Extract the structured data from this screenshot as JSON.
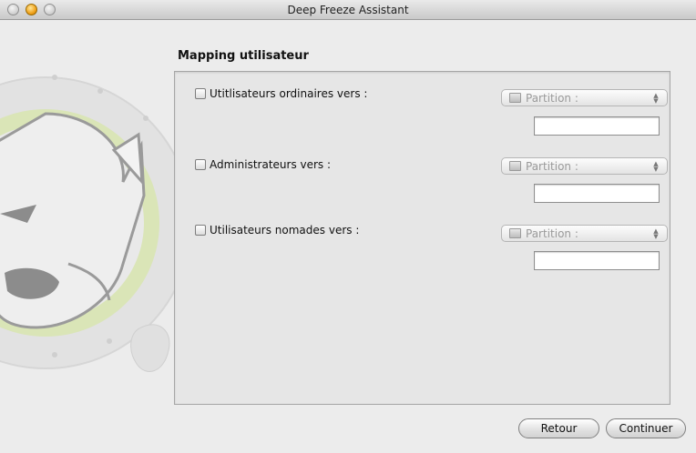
{
  "window": {
    "title": "Deep Freeze Assistant"
  },
  "section_title": "Mapping utilisateur",
  "rows": [
    {
      "label": "Utitlisateurs ordinaires vers :",
      "checked": false,
      "popup": "Partition :",
      "field_value": ""
    },
    {
      "label": "Administrateurs vers :",
      "checked": false,
      "popup": "Partition :",
      "field_value": ""
    },
    {
      "label": "Utilisateurs nomades vers :",
      "checked": false,
      "popup": "Partition :",
      "field_value": ""
    }
  ],
  "buttons": {
    "back_label": "Retour",
    "continue_label": "Continuer"
  },
  "colors": {
    "window_bg": "#ececec",
    "panel_bg": "#e6e6e6",
    "minimize_button": "#f0a21b",
    "mascot_ring": "#d7e6a8"
  },
  "icons": [
    "close-icon",
    "minimize-icon",
    "zoom-icon",
    "polar-bear-logo",
    "disk-icon",
    "stepper-icon"
  ]
}
